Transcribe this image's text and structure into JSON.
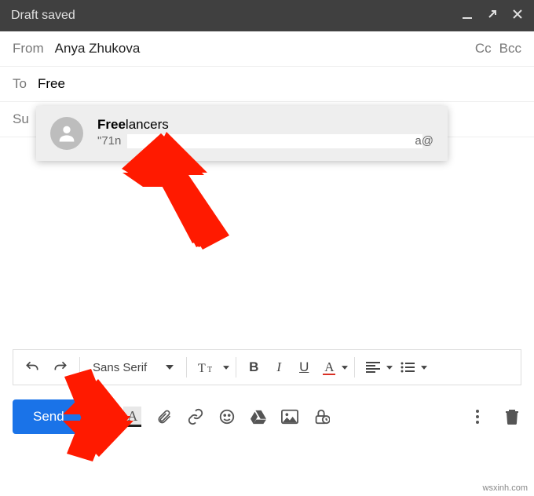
{
  "header": {
    "title": "Draft saved"
  },
  "from": {
    "label": "From",
    "value": "Anya Zhukova"
  },
  "cc": "Cc",
  "bcc": "Bcc",
  "to": {
    "label": "To",
    "value": "Free"
  },
  "subject": {
    "prefix": "Su"
  },
  "suggestion": {
    "name_match": "Free",
    "name_rest": "lancers",
    "email_prefix": "\"71n",
    "email_suffix": "a@"
  },
  "toolbar": {
    "font": "Sans Serif",
    "bold": "B",
    "italic": "I",
    "underline": "U",
    "text_color": "A",
    "format_a": "A"
  },
  "send": {
    "label": "Send"
  },
  "watermark": "wsxinh.com"
}
